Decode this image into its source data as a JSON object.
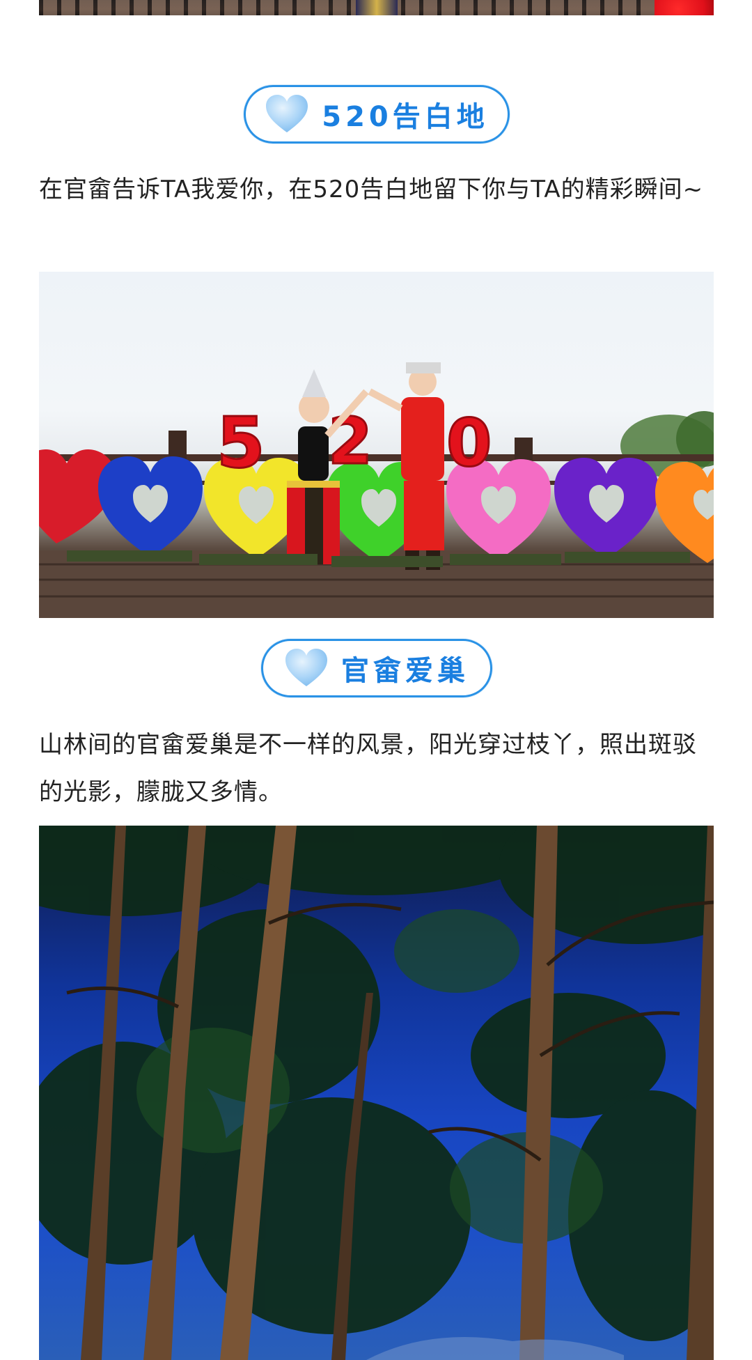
{
  "sections": [
    {
      "title": "520告白地",
      "paragraph": "在官畲告诉TA我爱你，在520告白地留下你与TA的精彩瞬间~",
      "photo_sign_text": "520"
    },
    {
      "title": "官畲爱巢",
      "paragraph": "山林间的官畲爱巢是不一样的风景，阳光穿过枝丫，照出斑驳的光影，朦胧又多情。"
    }
  ],
  "colors": {
    "accent": "#1a7fe0",
    "pill_border": "#2a92e6",
    "heart_fill": "#a9d4f7",
    "text": "#222222",
    "background": "#ffffff"
  },
  "icons": {
    "section_heart": "heart-icon"
  }
}
